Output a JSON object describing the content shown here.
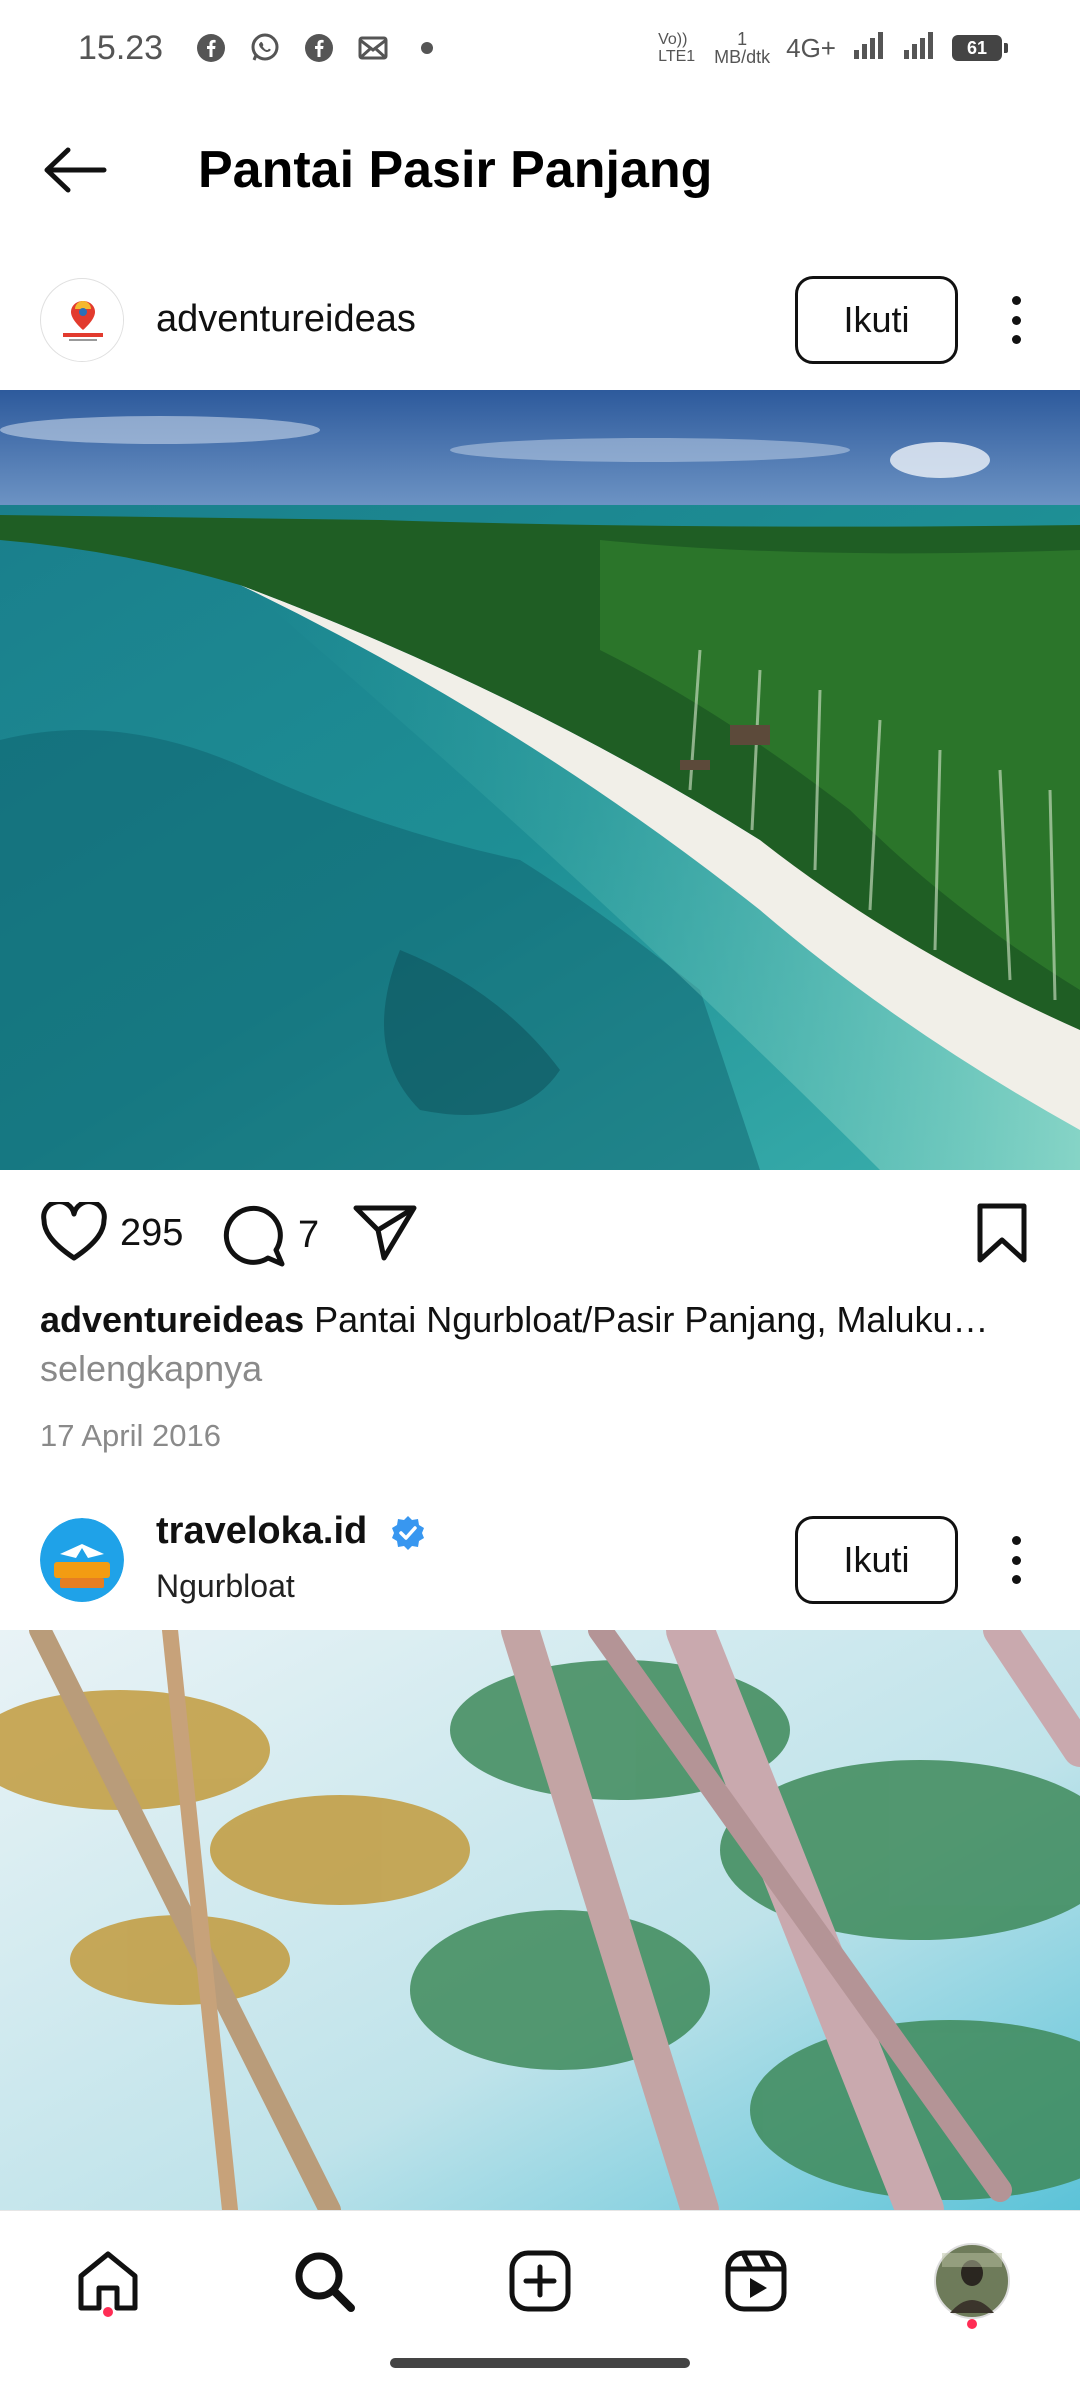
{
  "status_bar": {
    "time": "15.23",
    "icons": [
      "facebook-icon",
      "whatsapp-icon",
      "facebook-icon",
      "mail-icon",
      "dot-icon"
    ],
    "volte": "Vo)) LTE1",
    "net_rate_value": "1",
    "net_rate_unit": "MB/dtk",
    "network": "4G+",
    "battery": "61"
  },
  "header": {
    "title": "Pantai Pasir Panjang",
    "back_icon": "arrow-left-icon"
  },
  "posts": [
    {
      "username": "adventureideas",
      "follow_label": "Ikuti",
      "likes": "295",
      "comments": "7",
      "caption_user": "adventureideas",
      "caption_text": " Pantai Ngurbloat/Pasir Panjang, Maluku…",
      "more_label": "selengkapnya",
      "date": "17 April 2016"
    },
    {
      "username": "traveloka.id",
      "location": "Ngurbloat",
      "follow_label": "Ikuti",
      "verified": true
    }
  ],
  "bottom_nav": {
    "items": [
      "home-icon",
      "search-icon",
      "create-icon",
      "reels-icon",
      "profile-avatar"
    ]
  },
  "colors": {
    "accent_verified": "#3897f0",
    "notification_dot": "#ff2d55"
  }
}
